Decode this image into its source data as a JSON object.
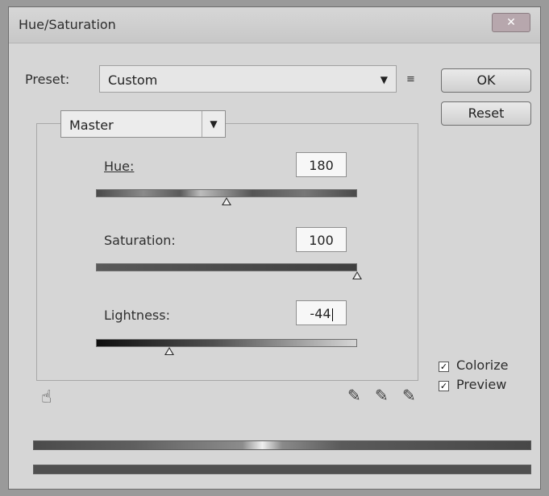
{
  "window": {
    "title": "Hue/Saturation",
    "close_glyph": "✕"
  },
  "preset": {
    "label": "Preset:",
    "value": "Custom",
    "arrow": "▼",
    "options_icon": "≡"
  },
  "buttons": {
    "ok": "OK",
    "reset": "Reset"
  },
  "channel": {
    "value": "Master",
    "arrow": "▼"
  },
  "hue": {
    "label": "Hue:",
    "value": "180",
    "level": 0.5
  },
  "saturation": {
    "label": "Saturation:",
    "value": "100",
    "level": 1.0
  },
  "lightness": {
    "label": "Lightness:",
    "value": "-44",
    "level": 0.28
  },
  "checkboxes": {
    "colorize": {
      "label": "Colorize",
      "checked": true
    },
    "preview": {
      "label": "Preview",
      "checked": true
    }
  },
  "icons": {
    "hand_tool": "☝",
    "eyedropper": "✎",
    "eyedropper_plus": "✎",
    "eyedropper_minus": "✎"
  },
  "colors": {
    "dialog_bg": "#d6d6d6",
    "button_border": "#6f6f6f",
    "track_dark": "#4f4f4f"
  }
}
